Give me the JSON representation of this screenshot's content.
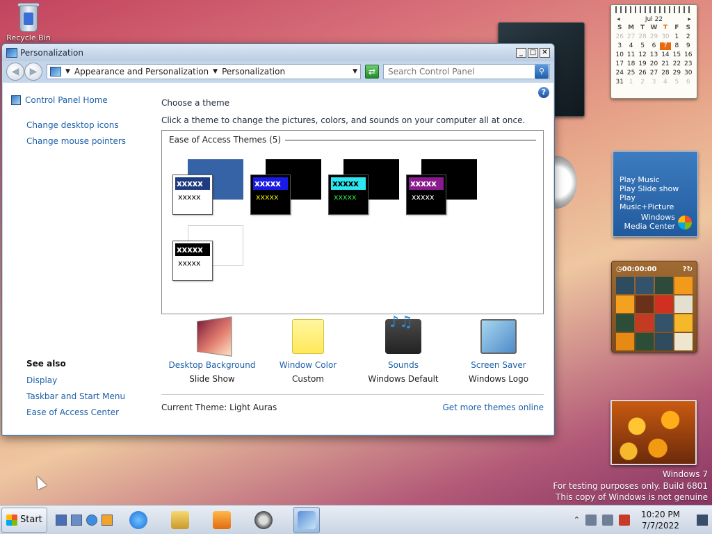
{
  "desktop": {
    "recycle_label": "Recycle Bin",
    "watermark": [
      "Windows  7",
      "For testing purposes only. Build 6801",
      "This copy of Windows is not genuine"
    ]
  },
  "gadgets": {
    "calendar": {
      "month": "Jul 22",
      "weekdays": [
        "S",
        "M",
        "T",
        "W",
        "T",
        "F",
        "S"
      ],
      "today": "7"
    },
    "media_center": {
      "items": [
        "Play Music",
        "Play Slide show",
        "Play Music+Picture"
      ],
      "brand_line1": "Windows",
      "brand_line2": "Media Center"
    },
    "puzzle": {
      "timer": "00:00:00"
    }
  },
  "window": {
    "title": "Personalization",
    "controls": {
      "minimize": "_",
      "maximize": "□",
      "close": "✕"
    },
    "breadcrumb": {
      "level1": "Appearance and Personalization",
      "level2": "Personalization"
    },
    "search_placeholder": "Search Control Panel",
    "help": "?"
  },
  "sidebar": {
    "home": "Control Panel Home",
    "links": [
      "Change desktop icons",
      "Change mouse pointers"
    ],
    "see_also_title": "See also",
    "see_also": [
      "Display",
      "Taskbar and Start Menu",
      "Ease of Access Center"
    ]
  },
  "main": {
    "heading": "Choose a theme",
    "description": "Click a theme to change the pictures, colors, and sounds on your computer all at once.",
    "group_title": "Ease of Access Themes (5)",
    "themes": [
      {
        "caption": "xxxxx",
        "text": "xxxxx",
        "back": "#3563a6",
        "frame": "#ffffff",
        "cap_bg": "#1f3c82",
        "cap_fg": "#ffffff",
        "txt_fg": "#000000",
        "body_bg": "#ffffff"
      },
      {
        "caption": "xxxxx",
        "text": "xxxxx",
        "back": "#000000",
        "frame": "#000000",
        "cap_bg": "#1a1ae8",
        "cap_fg": "#ffffff",
        "txt_fg": "#e8e800",
        "body_bg": "#000000"
      },
      {
        "caption": "xxxxx",
        "text": "xxxxx",
        "back": "#000000",
        "frame": "#000000",
        "cap_bg": "#2ee6f0",
        "cap_fg": "#000000",
        "txt_fg": "#2ee640",
        "body_bg": "#000000"
      },
      {
        "caption": "xxxxx",
        "text": "xxxxx",
        "back": "#000000",
        "frame": "#000000",
        "cap_bg": "#8a1a90",
        "cap_fg": "#ffffff",
        "txt_fg": "#ffffff",
        "body_bg": "#000000"
      },
      {
        "caption": "xxxxx",
        "text": "xxxxx",
        "back": "#ffffff",
        "frame": "#ffffff",
        "cap_bg": "#000000",
        "cap_fg": "#ffffff",
        "txt_fg": "#000000",
        "body_bg": "#ffffff"
      }
    ],
    "settings": [
      {
        "link": "Desktop Background",
        "value": "Slide Show",
        "icon": "desktop-background-icon"
      },
      {
        "link": "Window Color",
        "value": "Custom",
        "icon": "window-color-icon"
      },
      {
        "link": "Sounds",
        "value": "Windows Default",
        "icon": "sounds-icon"
      },
      {
        "link": "Screen Saver",
        "value": "Windows Logo",
        "icon": "screen-saver-icon"
      }
    ],
    "current_theme_label": "Current Theme:",
    "current_theme_value": "Light Auras",
    "more_online": "Get more themes online"
  },
  "taskbar": {
    "start": "Start",
    "time": "10:20 PM",
    "date": "7/7/2022"
  }
}
